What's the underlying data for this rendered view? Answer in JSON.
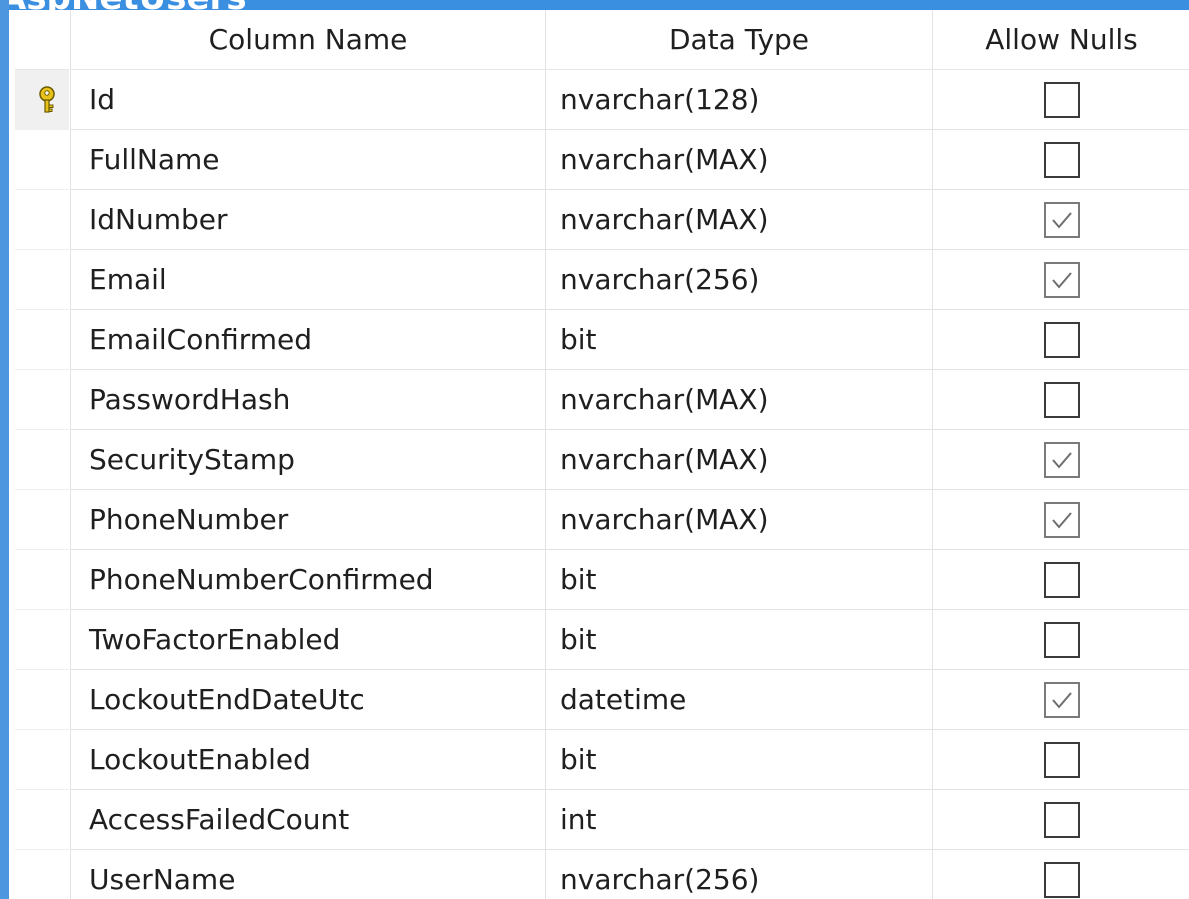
{
  "window": {
    "title": "AspNetUsers"
  },
  "table": {
    "headers": {
      "column_name": "Column Name",
      "data_type": "Data Type",
      "allow_nulls": "Allow Nulls"
    },
    "rows": [
      {
        "name": "Id",
        "type": "nvarchar(128)",
        "allow_nulls": false,
        "primary_key": true
      },
      {
        "name": "FullName",
        "type": "nvarchar(MAX)",
        "allow_nulls": false,
        "primary_key": false
      },
      {
        "name": "IdNumber",
        "type": "nvarchar(MAX)",
        "allow_nulls": true,
        "primary_key": false
      },
      {
        "name": "Email",
        "type": "nvarchar(256)",
        "allow_nulls": true,
        "primary_key": false
      },
      {
        "name": "EmailConfirmed",
        "type": "bit",
        "allow_nulls": false,
        "primary_key": false
      },
      {
        "name": "PasswordHash",
        "type": "nvarchar(MAX)",
        "allow_nulls": false,
        "primary_key": false
      },
      {
        "name": "SecurityStamp",
        "type": "nvarchar(MAX)",
        "allow_nulls": true,
        "primary_key": false
      },
      {
        "name": "PhoneNumber",
        "type": "nvarchar(MAX)",
        "allow_nulls": true,
        "primary_key": false
      },
      {
        "name": "PhoneNumberConfirmed",
        "type": "bit",
        "allow_nulls": false,
        "primary_key": false
      },
      {
        "name": "TwoFactorEnabled",
        "type": "bit",
        "allow_nulls": false,
        "primary_key": false
      },
      {
        "name": "LockoutEndDateUtc",
        "type": "datetime",
        "allow_nulls": true,
        "primary_key": false
      },
      {
        "name": "LockoutEnabled",
        "type": "bit",
        "allow_nulls": false,
        "primary_key": false
      },
      {
        "name": "AccessFailedCount",
        "type": "int",
        "allow_nulls": false,
        "primary_key": false
      },
      {
        "name": "UserName",
        "type": "nvarchar(256)",
        "allow_nulls": false,
        "primary_key": false
      }
    ]
  },
  "colors": {
    "title_bar": "#3b8fe0",
    "grid_line": "#e3e3e3",
    "key_icon": "#e8c21a"
  },
  "icons": {
    "primary_key": "key-icon",
    "checked": "checkmark-icon"
  }
}
